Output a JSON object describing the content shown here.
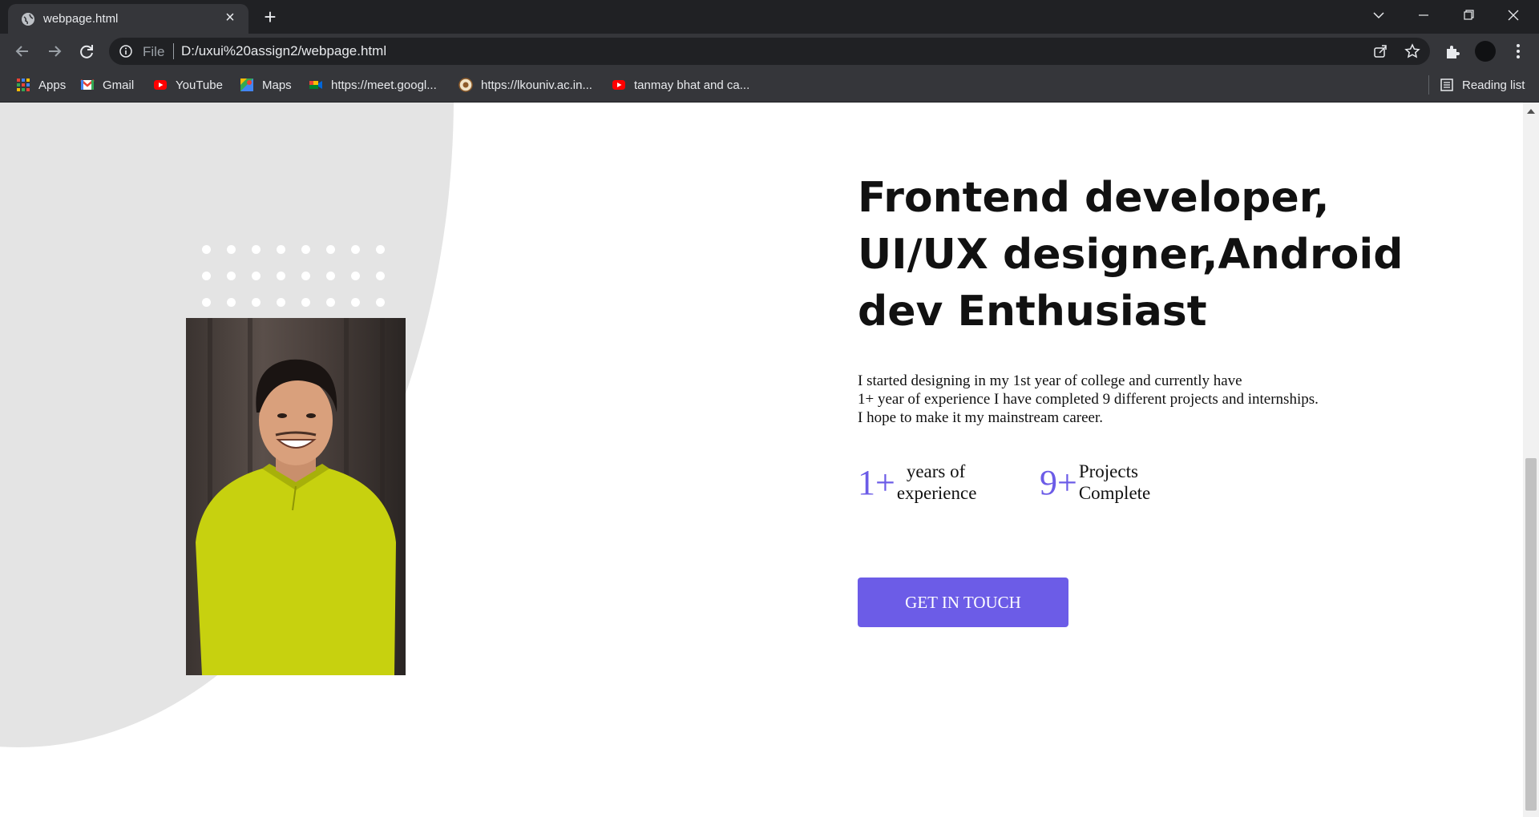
{
  "browser": {
    "tab": {
      "title": "webpage.html"
    },
    "omnibox": {
      "scheme": "File",
      "url": "D:/uxui%20assign2/webpage.html"
    },
    "bookmarks": [
      {
        "label": "Apps",
        "icon": "apps-grid-icon"
      },
      {
        "label": "Gmail",
        "icon": "gmail-icon"
      },
      {
        "label": "YouTube",
        "icon": "youtube-icon"
      },
      {
        "label": "Maps",
        "icon": "maps-icon"
      },
      {
        "label": "https://meet.googl...",
        "icon": "meet-icon"
      },
      {
        "label": "https://lkouniv.ac.in...",
        "icon": "university-icon"
      },
      {
        "label": "tanmay bhat and ca...",
        "icon": "youtube-icon"
      }
    ],
    "reading_list": "Reading list"
  },
  "page": {
    "headline": "Frontend developer, UI/UX designer,Android dev Enthusiast",
    "about_lines": [
      "I started designing in my 1st year of college and currently have",
      "1+ year of experience I have completed 9 different projects and internships.",
      "I hope to make it my mainstream career."
    ],
    "stats": [
      {
        "number": "1+",
        "label_line1": "years of",
        "label_line2": "experience"
      },
      {
        "number": "9+",
        "label_line1": "Projects",
        "label_line2": "Complete"
      }
    ],
    "cta_label": "GET IN TOUCH"
  },
  "colors": {
    "accent": "#6c5ce7",
    "chrome_dark": "#202124",
    "chrome_mid": "#35363a",
    "background_blob": "#e4e4e4"
  }
}
